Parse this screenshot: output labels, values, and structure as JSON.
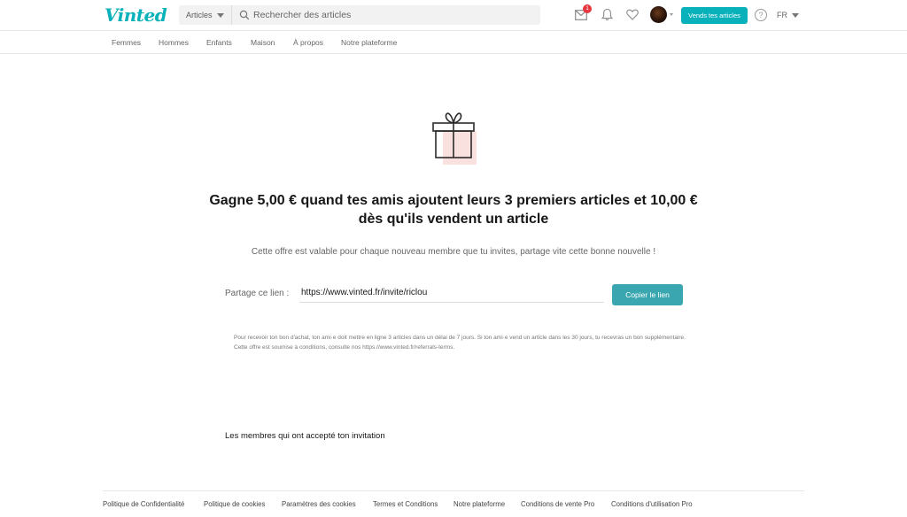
{
  "header": {
    "logo_text": "Vinted",
    "category_select": "Articles",
    "search_placeholder": "Rechercher des articles",
    "inbox_badge_count": "1",
    "sell_button": "Vends tes articles",
    "help_symbol": "?",
    "language": "FR",
    "brand_color": "#09b1ba",
    "icons": [
      "search-icon",
      "mail-icon",
      "bell-icon",
      "heart-icon",
      "avatar",
      "help-icon"
    ]
  },
  "nav": {
    "items": [
      "Femmes",
      "Hommes",
      "Enfants",
      "Maison",
      "À propos",
      "Notre plateforme"
    ]
  },
  "main": {
    "gift_icon": "gift-icon",
    "title": "Gagne 5,00 € quand tes amis ajoutent leurs 3 premiers articles et 10,00 € dès qu'ils vendent un article",
    "subtitle": "Cette offre est valable pour chaque nouveau membre que tu invites, partage vite cette bonne nouvelle !",
    "share_label": "Partage ce lien :",
    "share_link": "https://www.vinted.fr/invite/riclou",
    "copy_button": "Copier le lien",
    "fine_print": "Pour recevoir ton bon d'achat, ton ami·e doit mettre en ligne 3 articles dans un délai de 7 jours. Si ton ami·e vend un article dans les 30 jours, tu recevras un bon supplémentaire. Cette offre est soumise à conditions, consulte nos https://www.vinted.fr/referrals-terms.",
    "members_title": "Les membres qui ont accepté ton invitation"
  },
  "footer": {
    "links": [
      "Politique de Confidentialité",
      "Politique de cookies",
      "Paramètres des cookies",
      "Termes et Conditions",
      "Notre plateforme",
      "Conditions de vente Pro",
      "Conditions d'utilisation Pro"
    ]
  }
}
